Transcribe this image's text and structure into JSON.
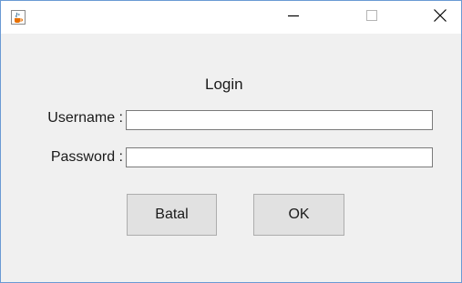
{
  "window": {
    "title": "",
    "icon": "java-cup-icon",
    "controls": {
      "minimize": "minimize-icon",
      "maximize": "maximize-icon",
      "close": "close-icon"
    },
    "colors": {
      "border": "#6a9ad4",
      "client_background": "#f0f0f0",
      "titlebar_background": "#ffffff"
    }
  },
  "form": {
    "heading": "Login",
    "username_label": "Username :",
    "username_value": "",
    "password_label": "Password :",
    "password_value": "",
    "cancel_label": "Batal",
    "ok_label": "OK"
  }
}
